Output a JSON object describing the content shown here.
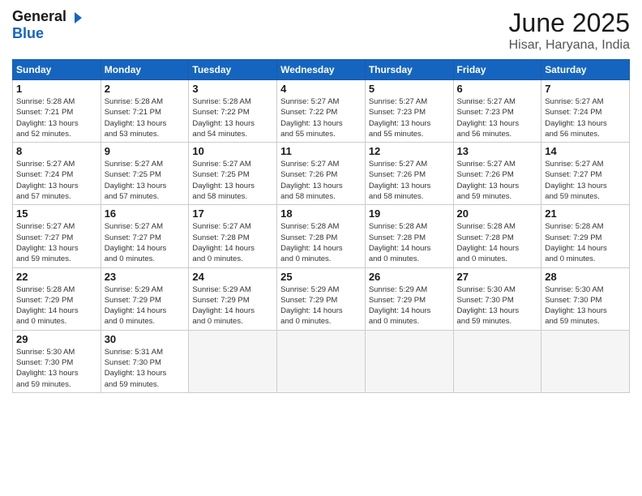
{
  "header": {
    "logo_general": "General",
    "logo_blue": "Blue",
    "month_title": "June 2025",
    "location": "Hisar, Haryana, India"
  },
  "weekdays": [
    "Sunday",
    "Monday",
    "Tuesday",
    "Wednesday",
    "Thursday",
    "Friday",
    "Saturday"
  ],
  "weeks": [
    [
      {
        "day": "1",
        "info": "Sunrise: 5:28 AM\nSunset: 7:21 PM\nDaylight: 13 hours\nand 52 minutes."
      },
      {
        "day": "2",
        "info": "Sunrise: 5:28 AM\nSunset: 7:21 PM\nDaylight: 13 hours\nand 53 minutes."
      },
      {
        "day": "3",
        "info": "Sunrise: 5:28 AM\nSunset: 7:22 PM\nDaylight: 13 hours\nand 54 minutes."
      },
      {
        "day": "4",
        "info": "Sunrise: 5:27 AM\nSunset: 7:22 PM\nDaylight: 13 hours\nand 55 minutes."
      },
      {
        "day": "5",
        "info": "Sunrise: 5:27 AM\nSunset: 7:23 PM\nDaylight: 13 hours\nand 55 minutes."
      },
      {
        "day": "6",
        "info": "Sunrise: 5:27 AM\nSunset: 7:23 PM\nDaylight: 13 hours\nand 56 minutes."
      },
      {
        "day": "7",
        "info": "Sunrise: 5:27 AM\nSunset: 7:24 PM\nDaylight: 13 hours\nand 56 minutes."
      }
    ],
    [
      {
        "day": "8",
        "info": "Sunrise: 5:27 AM\nSunset: 7:24 PM\nDaylight: 13 hours\nand 57 minutes."
      },
      {
        "day": "9",
        "info": "Sunrise: 5:27 AM\nSunset: 7:25 PM\nDaylight: 13 hours\nand 57 minutes."
      },
      {
        "day": "10",
        "info": "Sunrise: 5:27 AM\nSunset: 7:25 PM\nDaylight: 13 hours\nand 58 minutes."
      },
      {
        "day": "11",
        "info": "Sunrise: 5:27 AM\nSunset: 7:26 PM\nDaylight: 13 hours\nand 58 minutes."
      },
      {
        "day": "12",
        "info": "Sunrise: 5:27 AM\nSunset: 7:26 PM\nDaylight: 13 hours\nand 58 minutes."
      },
      {
        "day": "13",
        "info": "Sunrise: 5:27 AM\nSunset: 7:26 PM\nDaylight: 13 hours\nand 59 minutes."
      },
      {
        "day": "14",
        "info": "Sunrise: 5:27 AM\nSunset: 7:27 PM\nDaylight: 13 hours\nand 59 minutes."
      }
    ],
    [
      {
        "day": "15",
        "info": "Sunrise: 5:27 AM\nSunset: 7:27 PM\nDaylight: 13 hours\nand 59 minutes."
      },
      {
        "day": "16",
        "info": "Sunrise: 5:27 AM\nSunset: 7:27 PM\nDaylight: 14 hours\nand 0 minutes."
      },
      {
        "day": "17",
        "info": "Sunrise: 5:27 AM\nSunset: 7:28 PM\nDaylight: 14 hours\nand 0 minutes."
      },
      {
        "day": "18",
        "info": "Sunrise: 5:28 AM\nSunset: 7:28 PM\nDaylight: 14 hours\nand 0 minutes."
      },
      {
        "day": "19",
        "info": "Sunrise: 5:28 AM\nSunset: 7:28 PM\nDaylight: 14 hours\nand 0 minutes."
      },
      {
        "day": "20",
        "info": "Sunrise: 5:28 AM\nSunset: 7:28 PM\nDaylight: 14 hours\nand 0 minutes."
      },
      {
        "day": "21",
        "info": "Sunrise: 5:28 AM\nSunset: 7:29 PM\nDaylight: 14 hours\nand 0 minutes."
      }
    ],
    [
      {
        "day": "22",
        "info": "Sunrise: 5:28 AM\nSunset: 7:29 PM\nDaylight: 14 hours\nand 0 minutes."
      },
      {
        "day": "23",
        "info": "Sunrise: 5:29 AM\nSunset: 7:29 PM\nDaylight: 14 hours\nand 0 minutes."
      },
      {
        "day": "24",
        "info": "Sunrise: 5:29 AM\nSunset: 7:29 PM\nDaylight: 14 hours\nand 0 minutes."
      },
      {
        "day": "25",
        "info": "Sunrise: 5:29 AM\nSunset: 7:29 PM\nDaylight: 14 hours\nand 0 minutes."
      },
      {
        "day": "26",
        "info": "Sunrise: 5:29 AM\nSunset: 7:29 PM\nDaylight: 14 hours\nand 0 minutes."
      },
      {
        "day": "27",
        "info": "Sunrise: 5:30 AM\nSunset: 7:30 PM\nDaylight: 13 hours\nand 59 minutes."
      },
      {
        "day": "28",
        "info": "Sunrise: 5:30 AM\nSunset: 7:30 PM\nDaylight: 13 hours\nand 59 minutes."
      }
    ],
    [
      {
        "day": "29",
        "info": "Sunrise: 5:30 AM\nSunset: 7:30 PM\nDaylight: 13 hours\nand 59 minutes."
      },
      {
        "day": "30",
        "info": "Sunrise: 5:31 AM\nSunset: 7:30 PM\nDaylight: 13 hours\nand 59 minutes."
      },
      {
        "day": "",
        "info": ""
      },
      {
        "day": "",
        "info": ""
      },
      {
        "day": "",
        "info": ""
      },
      {
        "day": "",
        "info": ""
      },
      {
        "day": "",
        "info": ""
      }
    ]
  ]
}
